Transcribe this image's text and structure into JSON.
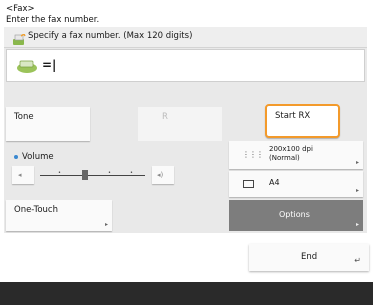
{
  "header": {
    "tag": "<Fax>",
    "instruction": "Enter the fax number."
  },
  "panel": {
    "title": "Specify a fax number. (Max 120 digits)",
    "input_value": "=|"
  },
  "buttons": {
    "tone": "Tone",
    "r": "R",
    "start_rx": "Start RX",
    "one_touch": "One-Touch",
    "resolution_line1": "200x100 dpi",
    "resolution_line2": "(Normal)",
    "paper": "A4",
    "options": "Options",
    "end": "End"
  },
  "volume": {
    "label": "Volume",
    "level": 0.42
  },
  "colors": {
    "accent": "#f39a2b",
    "volume_dot": "#3a88d0"
  }
}
